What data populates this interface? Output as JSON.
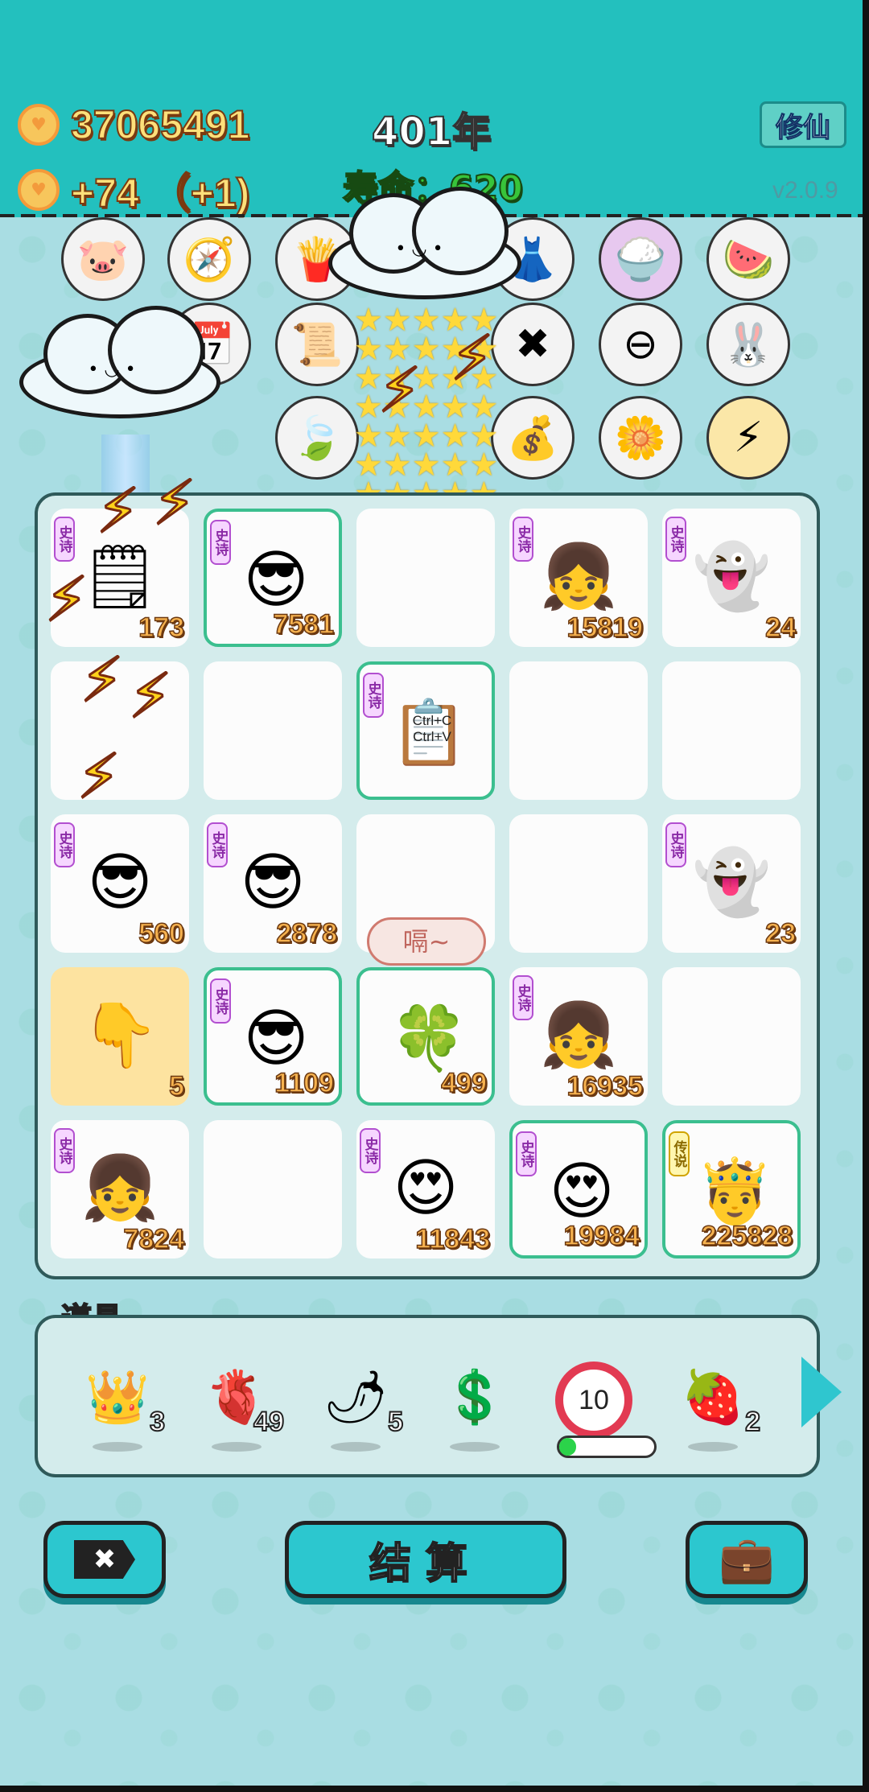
{
  "header": {
    "coins": "37065491",
    "gain": "+74 （+1)",
    "year": "401年",
    "life": "寿命：620",
    "xiuxian_label": "修仙",
    "version": "v2.0.9"
  },
  "skills": [
    {
      "name": "pig-icon",
      "glyph": "🐷"
    },
    {
      "name": "compass-icon",
      "glyph": "🧭"
    },
    {
      "name": "fries-icon",
      "glyph": "🍟"
    },
    {
      "name": "skirt-icon",
      "glyph": "👗"
    },
    {
      "name": "rice-bowl-icon",
      "glyph": "🍚"
    },
    {
      "name": "fruit-platter-icon",
      "glyph": "🍉"
    },
    {
      "name": "calendar-icon",
      "glyph": "📅"
    },
    {
      "name": "talisman-icon",
      "glyph": "📜"
    },
    {
      "name": "delete-tag-icon",
      "glyph": "✖"
    },
    {
      "name": "minus-circle-icon",
      "glyph": "⊖"
    },
    {
      "name": "rabbit-icon",
      "glyph": "🐰"
    },
    {
      "name": "leaf-icon",
      "glyph": "🍃"
    },
    {
      "name": "sack-icon",
      "glyph": "💰"
    },
    {
      "name": "flower-pot-icon",
      "glyph": "🌼"
    },
    {
      "name": "lightning-icon",
      "glyph": "⚡"
    }
  ],
  "board": {
    "tags": {
      "epic": "史诗",
      "legend": "传说"
    },
    "cells": [
      {
        "count": "173",
        "face": "🗒",
        "tag": "epic"
      },
      {
        "count": "7581",
        "face": "😎",
        "tag": "epic"
      },
      {
        "count": "",
        "face": "",
        "tag": ""
      },
      {
        "count": "15819",
        "face": "👧",
        "tag": "epic"
      },
      {
        "count": "24",
        "face": "👻",
        "tag": "epic"
      },
      {
        "count": "",
        "face": "",
        "tag": ""
      },
      {
        "count": "",
        "face": "",
        "tag": ""
      },
      {
        "count": "",
        "face": "📋",
        "tag": "epic",
        "card_text": "Ctrl+C Ctrl+V"
      },
      {
        "count": "",
        "face": "",
        "tag": ""
      },
      {
        "count": "",
        "face": "",
        "tag": ""
      },
      {
        "count": "560",
        "face": "😎",
        "tag": "epic"
      },
      {
        "count": "2878",
        "face": "😎",
        "tag": "epic"
      },
      {
        "count": "",
        "face": "",
        "tag": ""
      },
      {
        "count": "",
        "face": "",
        "tag": ""
      },
      {
        "count": "23",
        "face": "👻",
        "tag": "epic"
      },
      {
        "count": "5",
        "face": "👇",
        "tag": ""
      },
      {
        "count": "1109",
        "face": "😎",
        "tag": "epic"
      },
      {
        "count": "499",
        "face": "🍀",
        "tag": ""
      },
      {
        "count": "16935",
        "face": "👧",
        "tag": "epic"
      },
      {
        "count": "",
        "face": "",
        "tag": ""
      },
      {
        "count": "7824",
        "face": "👧",
        "tag": "epic"
      },
      {
        "count": "",
        "face": "",
        "tag": ""
      },
      {
        "count": "11843",
        "face": "😍",
        "tag": "epic"
      },
      {
        "count": "19984",
        "face": "😍",
        "tag": "epic"
      },
      {
        "count": "225828",
        "face": "🤴",
        "tag": "legend"
      }
    ],
    "bubble": "嗝~"
  },
  "items": {
    "title": "道具",
    "list": [
      {
        "name": "crown-icon",
        "glyph": "👑",
        "count": "3"
      },
      {
        "name": "liver-icon",
        "glyph": "🫀",
        "count": "49"
      },
      {
        "name": "pepper-icon",
        "glyph": "🌶",
        "count": "5"
      },
      {
        "name": "coin-dollar-icon",
        "glyph": "💲",
        "count": ""
      },
      {
        "name": "target-ten-icon",
        "glyph": "10",
        "count": ""
      },
      {
        "name": "strawberry-icon",
        "glyph": "🍓",
        "count": "2"
      }
    ],
    "progress": 0.18
  },
  "buttons": {
    "settle_label": "结算"
  }
}
